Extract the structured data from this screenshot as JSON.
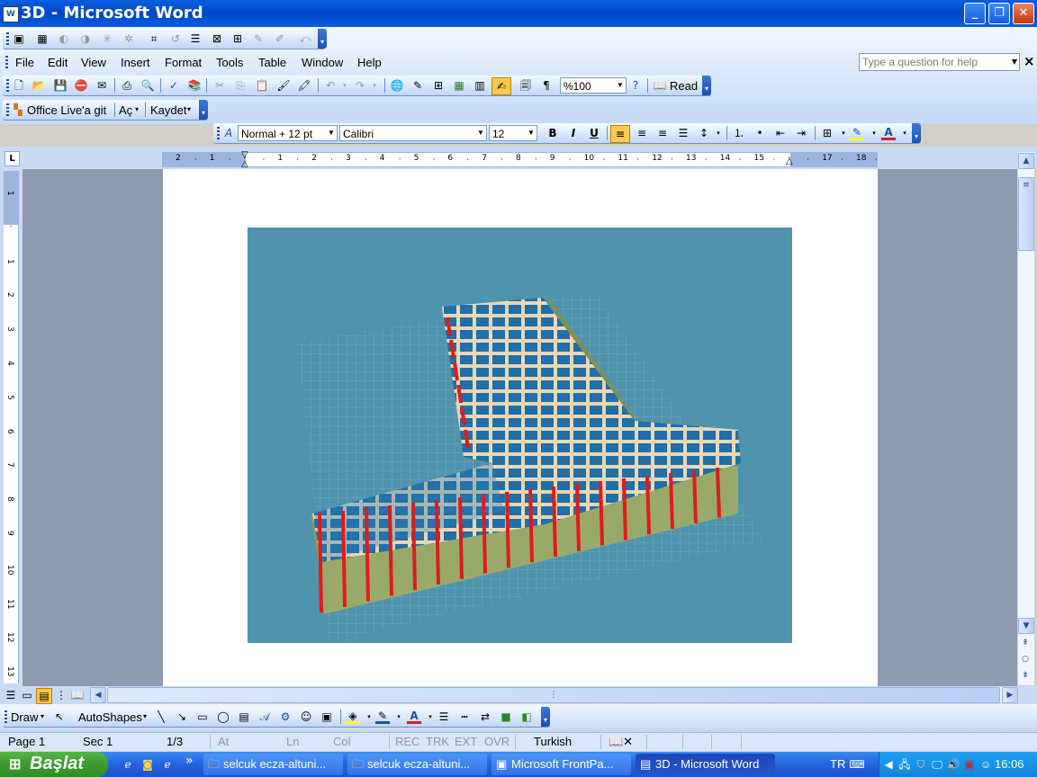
{
  "window": {
    "title": "3D - Microsoft Word",
    "app_icon": "word-doc-icon",
    "minimize": "_",
    "restore": "❐",
    "close": "✕"
  },
  "menu": {
    "items": [
      "File",
      "Edit",
      "View",
      "Insert",
      "Format",
      "Tools",
      "Table",
      "Window",
      "Help"
    ],
    "help_placeholder": "Type a question for help",
    "close_doc": "×"
  },
  "toolbar_live": {
    "office_live": "Office Live'a git",
    "open": "Aç",
    "save": "Kaydet"
  },
  "toolbar_standard": {
    "zoom": "%100",
    "read": "Read"
  },
  "toolbar_format": {
    "style": "Normal + 12 pt",
    "font": "Calibri",
    "size": "12",
    "bold": "B",
    "italic": "I",
    "underline": "U"
  },
  "ruler": {
    "h_labels": [
      "2",
      "1",
      "",
      "1",
      "2",
      "3",
      "4",
      "5",
      "6",
      "7",
      "8",
      "9",
      "10",
      "11",
      "12",
      "13",
      "14",
      "15",
      "",
      "17",
      "18"
    ],
    "v_labels": [
      "1",
      "",
      "1",
      "2",
      "3",
      "4",
      "5",
      "6",
      "7",
      "8",
      "9",
      "10",
      "11",
      "12",
      "13"
    ]
  },
  "drawing": {
    "draw": "Draw",
    "autoshapes": "AutoShapes"
  },
  "status": {
    "page": "Page 1",
    "section": "Sec 1",
    "pages": "1/3",
    "at": "At",
    "ln": "Ln",
    "col": "Col",
    "rec": "REC",
    "trk": "TRK",
    "ext": "EXT",
    "ovr": "OVR",
    "language": "Turkish"
  },
  "taskbar": {
    "start": "Başlat",
    "more": "»",
    "tasks": [
      {
        "label": "selcuk ecza-altuni...",
        "icon": "folder-icon",
        "active": false
      },
      {
        "label": "selcuk ecza-altuni...",
        "icon": "folder-icon",
        "active": false
      },
      {
        "label": "Microsoft FrontPa...",
        "icon": "frontpage-icon",
        "active": false
      },
      {
        "label": "3D - Microsoft Word",
        "icon": "word-icon",
        "active": true
      }
    ],
    "lang": "TR",
    "clock": "16:06"
  },
  "colors": {
    "scene_bg": "#4f93ad",
    "wall": "#98a96a",
    "roof": "#1f6fa8",
    "pillar": "#e01b1b",
    "trim": "#e8d6b4"
  }
}
